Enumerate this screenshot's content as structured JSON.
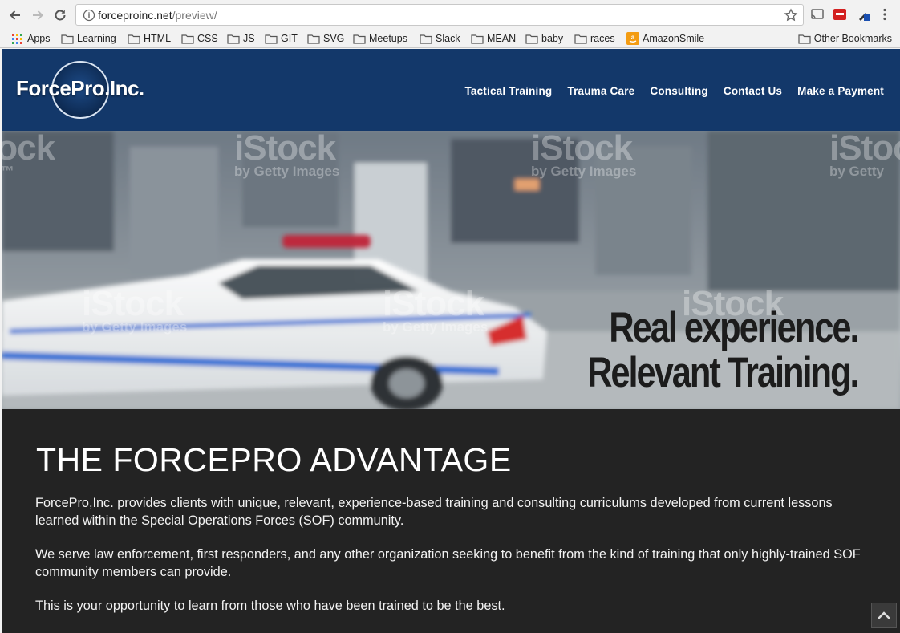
{
  "browser": {
    "url_host": "forceproinc.net",
    "url_path": "/preview/",
    "bookmarks": [
      {
        "label": "Apps",
        "icon": "apps-grid-icon"
      },
      {
        "label": "Learning",
        "icon": "folder-icon"
      },
      {
        "label": "HTML",
        "icon": "folder-icon"
      },
      {
        "label": "CSS",
        "icon": "folder-icon"
      },
      {
        "label": "JS",
        "icon": "folder-icon"
      },
      {
        "label": "GIT",
        "icon": "folder-icon"
      },
      {
        "label": "SVG",
        "icon": "folder-icon"
      },
      {
        "label": "Meetups",
        "icon": "folder-icon"
      },
      {
        "label": "Slack",
        "icon": "folder-icon"
      },
      {
        "label": "MEAN",
        "icon": "folder-icon"
      },
      {
        "label": "baby",
        "icon": "folder-icon"
      },
      {
        "label": "races",
        "icon": "folder-icon"
      },
      {
        "label": "AmazonSmile",
        "icon": "amazon-icon"
      }
    ],
    "other_bookmarks": "Other Bookmarks"
  },
  "site": {
    "logo_text": "ForcePro.Inc.",
    "nav": [
      "Tactical Training",
      "Trauma Care",
      "Consulting",
      "Contact Us",
      "Make a Payment"
    ],
    "hero": {
      "tagline_line1": "Real experience.",
      "tagline_line2": "Relevant Training.",
      "watermark_big": "iStock",
      "watermark_small": "by Getty Images"
    },
    "advantage": {
      "heading": "THE FORCEPRO ADVANTAGE",
      "paragraphs": [
        "ForcePro,Inc. provides clients with unique, relevant, experience-based training and consulting curriculums developed from current lessons learned within the Special Operations Forces (SOF) community.",
        "We serve law enforcement, first responders, and any other organization seeking to benefit from the kind of training that only highly-trained SOF community members can provide.",
        "This is your opportunity to learn from those who have been trained to be the best."
      ]
    }
  },
  "colors": {
    "header_blue": "#13386a",
    "section_dark": "#232323"
  }
}
